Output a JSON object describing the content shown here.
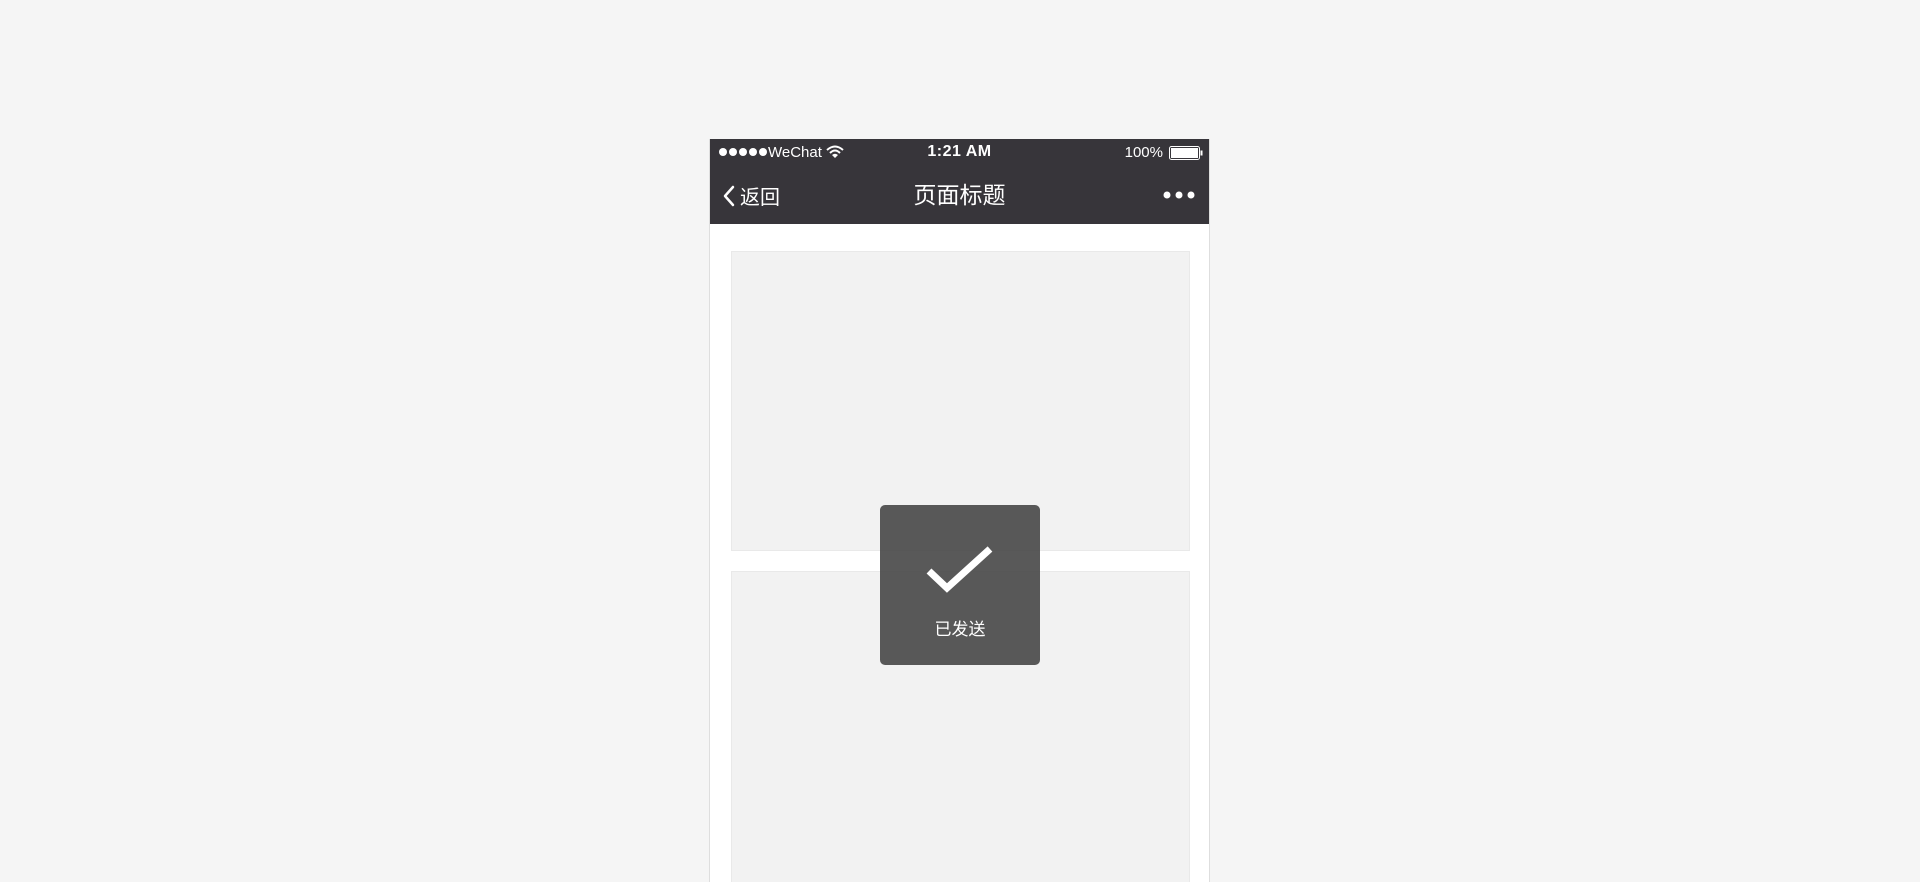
{
  "status_bar": {
    "carrier": "WeChat",
    "time": "1:21 AM",
    "battery": "100%"
  },
  "nav": {
    "back_label": "返回",
    "title": "页面标题",
    "more_icon": "more-dots-icon"
  },
  "toast": {
    "icon": "checkmark-icon",
    "text": "已发送"
  },
  "colors": {
    "header_bg": "#37353a",
    "page_bg": "#f5f5f5",
    "card_bg": "#f2f2f2",
    "toast_bg": "#474747"
  }
}
